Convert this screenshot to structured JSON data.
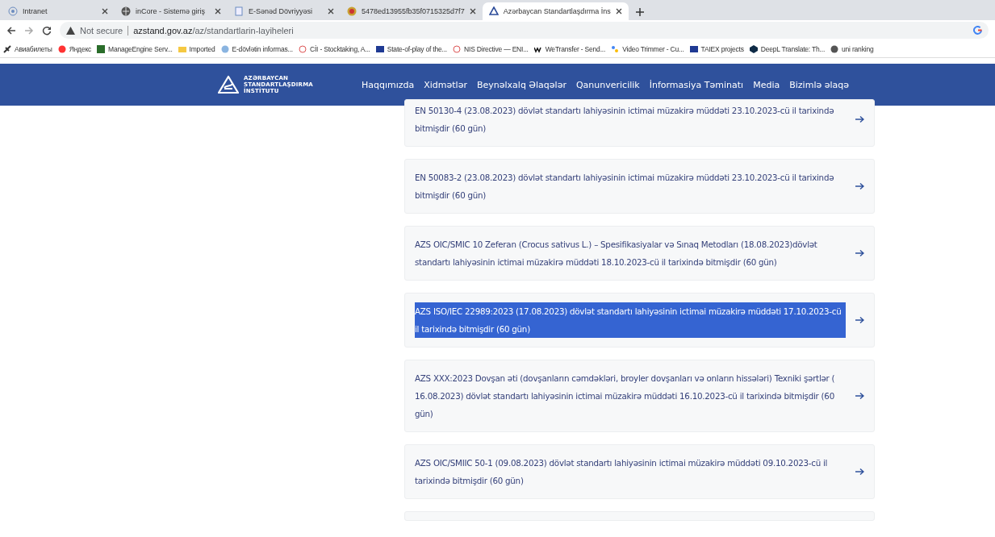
{
  "browser": {
    "tabs": [
      {
        "title": "Intranet",
        "selected": false
      },
      {
        "title": "inCore - Sistemə giriş",
        "selected": false
      },
      {
        "title": "E-Sənəd Dövriyyəsi",
        "selected": false
      },
      {
        "title": "5478ed13955fb35f0715325d7f7",
        "selected": false
      },
      {
        "title": "Azərbaycan Standartlaşdırma İns",
        "selected": true
      }
    ],
    "security": "Not secure",
    "url_host": "azstand.gov.az",
    "url_path": "/az/standartlarin-layiheleri",
    "bookmarks": [
      "Авиабилеты",
      "Яндекс",
      "ManageEngine Serv...",
      "Imported",
      "E-dövlətin informas...",
      "CİI - Stocktaking, A...",
      "State-of-play of the...",
      "NIS Directive — ENI...",
      "WeTransfer - Send...",
      "Video Trimmer - Cu...",
      "TAIEX projects",
      "DeepL Translate: Th...",
      "uni ranking"
    ]
  },
  "header": {
    "logo_lines": [
      "AZƏRBAYCAN",
      "STANDARTLAŞDIRMA",
      "İNSTİTUTU"
    ],
    "nav": [
      "Haqqımızda",
      "Xidmətlər",
      "Beynəlxalq Əlaqələr",
      "Qanunvericilik",
      "İnformasiya Təminatı",
      "Media",
      "Bizimlə əlaqə"
    ]
  },
  "items": [
    {
      "text": "EN 50130-4 (23.08.2023) dövlət standartı lahiyəsinin ictimai müzakirə müddəti 23.10.2023-cü il tarixində bitmişdir (60 gün)",
      "text_selected": false
    },
    {
      "text": "EN 50083-2 (23.08.2023) dövlət standartı lahiyəsinin ictimai müzakirə müddəti 23.10.2023-cü il tarixində bitmişdir (60 gün)",
      "text_selected": false
    },
    {
      "text": "AZS OIC/SMIC 10 Zeferan (Crocus sativus L.) – Spesifikasiyalar və Sınaq Metodları (18.08.2023)dövlət standartı lahiyəsinin ictimai müzakirə müddəti 18.10.2023-cü il tarixində bitmişdir (60 gün)",
      "text_selected": false
    },
    {
      "text": "AZS ISO/IEC 22989:2023 (17.08.2023) dövlət standartı lahiyəsinin ictimai müzakirə müddəti 17.10.2023-cü il tarixində bitmişdir (60 gün)",
      "text_selected": true
    },
    {
      "text": "AZS XXX:2023 Dovşan əti (dovşanların cəmdəkləri, broyler dovşanları və onların hissələri) Texniki şərtlər ( 16.08.2023) dövlət standartı lahiyəsinin ictimai müzakirə müddəti 16.10.2023-cü il tarixində bitmişdir (60 gün)",
      "text_selected": false
    },
    {
      "text": "AZS OIC/SMIIC 50-1 (09.08.2023) dövlət standartı lahiyəsinin ictimai müzakirə müddəti 09.10.2023-cü il tarixində bitmişdir (60 gün)",
      "text_selected": false
    }
  ]
}
